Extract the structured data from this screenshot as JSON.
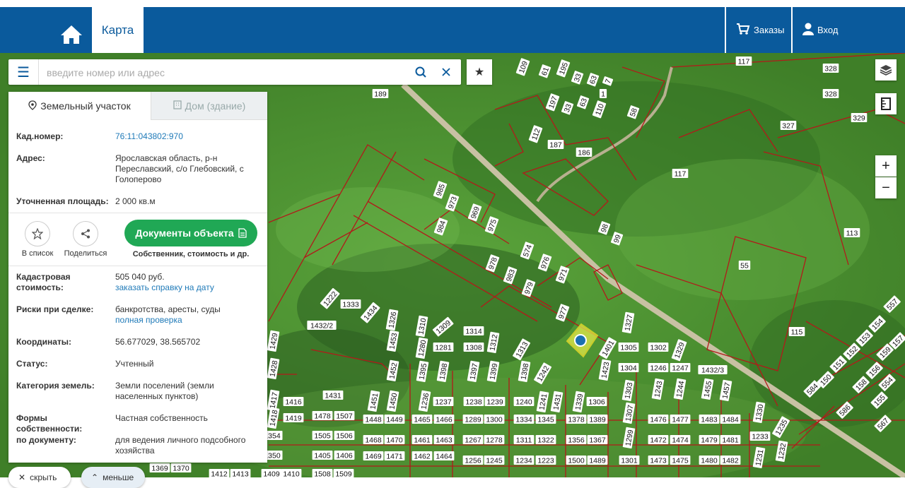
{
  "header": {
    "tab_map": "Карта",
    "orders": "Заказы",
    "login": "Вход"
  },
  "search": {
    "placeholder": "введите номер или адрес"
  },
  "panel": {
    "tab_land": "Земельный участок",
    "tab_house": "Дом (здание)",
    "cad_number_label": "Кад.номер:",
    "cad_number": "76:11:043802:970",
    "address_label": "Адрес:",
    "address": "Ярославская область, р-н Переславский, с/о Глебовский, с Голоперово",
    "area_label": "Уточненная площадь:",
    "area": "2 000 кв.м",
    "to_list": "В список",
    "share": "Поделиться",
    "docs_button": "Документы объекта",
    "docs_sub": "Собственник, стоимость и др.",
    "cost_label": "Кадастровая стоимость:",
    "cost": "505 040 руб.",
    "cost_link": "заказать справку на дату",
    "risks_label": "Риски при сделке:",
    "risks": "банкротства, аресты, суды",
    "risks_link": "полная проверка",
    "coords_label": "Координаты:",
    "coords": "56.677029, 38.565702",
    "status_label": "Статус:",
    "status": "Учтенный",
    "category_label": "Категория земель:",
    "category": "Земли поселений (земли населенных пунктов)",
    "ownership_label": "Формы собственности:",
    "ownership": "Частная собственность",
    "by_doc_label": "по документу:",
    "by_doc": "для ведения личного подсобного хозяйства"
  },
  "bottom": {
    "hide": "скрыть",
    "less": "меньше"
  },
  "map": {
    "parcel_labels": [
      "117",
      "328",
      "328",
      "329",
      "327",
      "113",
      "55",
      "115",
      "117",
      "109",
      "61",
      "195",
      "33",
      "63",
      "7",
      "1",
      "110",
      "58",
      "197",
      "33",
      "63",
      "112",
      "187",
      "186",
      "189",
      "985",
      "973",
      "969",
      "975",
      "984",
      "98",
      "99",
      "978",
      "574",
      "976",
      "983",
      "979",
      "971",
      "977",
      "1222",
      "1333",
      "1434",
      "1432/2",
      "1326",
      "1310",
      "1309",
      "1314",
      "1312",
      "1313",
      "1327",
      "1401",
      "1305",
      "1302",
      "1329",
      "1453",
      "1280",
      "1281",
      "1308",
      "1452",
      "1395",
      "1398",
      "1397",
      "1399",
      "1398",
      "1242",
      "1423",
      "1304",
      "1246",
      "1247",
      "1432/3",
      "1303",
      "1243",
      "1244",
      "1455",
      "1457",
      "1431",
      "1451",
      "1450",
      "1236",
      "1237",
      "1238",
      "1239",
      "1240",
      "1241",
      "1431",
      "1339",
      "1306",
      "1307",
      "1478",
      "1507",
      "1448",
      "1449",
      "1465",
      "1466",
      "1289",
      "1300",
      "1334",
      "1345",
      "1378",
      "1389",
      "1476",
      "1477",
      "1483",
      "1484",
      "1330",
      "1235",
      "1505",
      "1506",
      "1468",
      "1470",
      "1461",
      "1463",
      "1267",
      "1278",
      "1311",
      "1322",
      "1356",
      "1367",
      "1299",
      "1472",
      "1474",
      "1479",
      "1481",
      "1233",
      "1405",
      "1406",
      "1469",
      "1471",
      "1462",
      "1464",
      "1256",
      "1245",
      "1234",
      "1223",
      "1500",
      "1489",
      "1301",
      "1473",
      "1475",
      "1480",
      "1482",
      "1231",
      "1232",
      "1416",
      "1419",
      "1355",
      "1351",
      "1417",
      "1418",
      "1354",
      "1350",
      "1428",
      "1429",
      "1369",
      "1370",
      "1412",
      "1413",
      "1409",
      "1410",
      "1508",
      "1509",
      "154",
      "153",
      "152",
      "151",
      "150",
      "584",
      "586",
      "158",
      "159",
      "156",
      "157",
      "155",
      "554",
      "557",
      "567",
      "546"
    ]
  }
}
